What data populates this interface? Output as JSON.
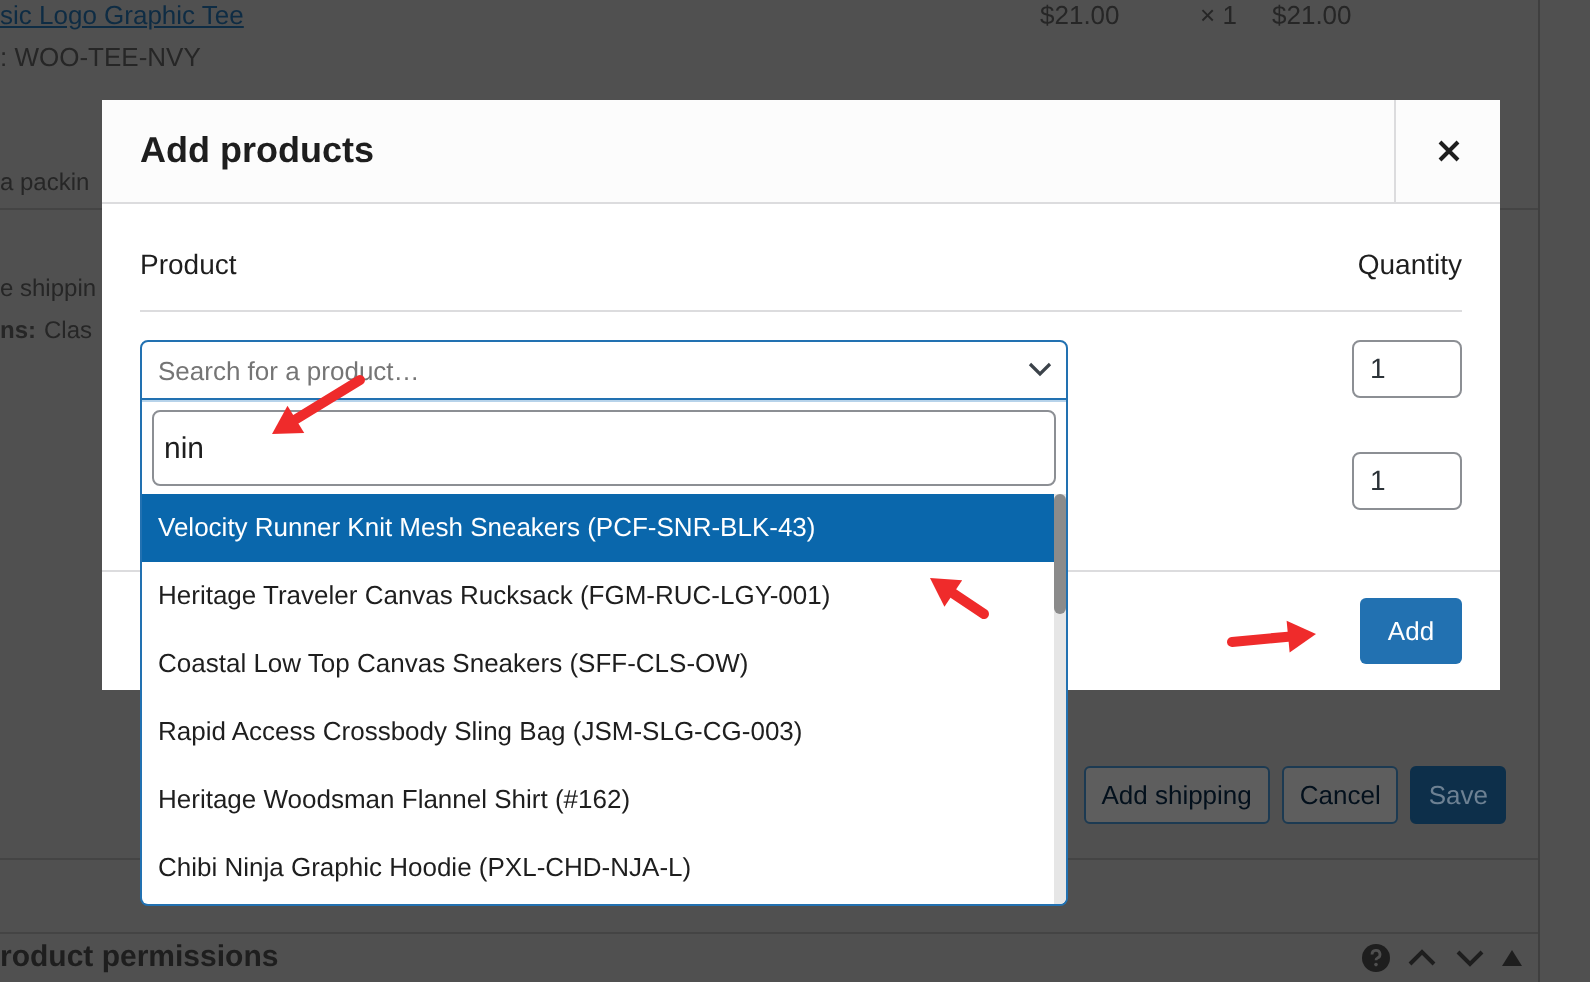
{
  "background": {
    "item_link": "sic Logo Graphic Tee",
    "item_price": "$21.00",
    "item_qty": "× 1",
    "item_total": "$21.00",
    "item_sku": ": WOO-TEE-NVY",
    "note": "a packin",
    "shipping_line": "e shippin",
    "shipping_meta_label": "ns:",
    "shipping_meta_value": "Clas",
    "buttons": [
      {
        "label": "Add shipping",
        "kind": "outline"
      },
      {
        "label": "Cancel",
        "kind": "outline"
      },
      {
        "label": "Save",
        "kind": "primary"
      }
    ],
    "panel_title": "roduct permissions"
  },
  "modal": {
    "title": "Add products",
    "columns": [
      "Product",
      "Quantity"
    ],
    "rows": [
      {
        "quantity": "1"
      },
      {
        "quantity": "1"
      }
    ],
    "select": {
      "placeholder": "Search for a product…",
      "search_value": "nin",
      "options": [
        {
          "label": "Velocity Runner Knit Mesh Sneakers (PCF-SNR-BLK-43)",
          "selected": true
        },
        {
          "label": "Heritage Traveler Canvas Rucksack (FGM-RUC-LGY-001)",
          "selected": false
        },
        {
          "label": "Coastal Low Top Canvas Sneakers (SFF-CLS-OW)",
          "selected": false
        },
        {
          "label": "Rapid Access Crossbody Sling Bag (JSM-SLG-CG-003)",
          "selected": false
        },
        {
          "label": "Heritage Woodsman Flannel Shirt (#162)",
          "selected": false
        },
        {
          "label": "Chibi Ninja Graphic Hoodie (PXL-CHD-NJA-L)",
          "selected": false
        }
      ]
    },
    "button": "Add"
  }
}
